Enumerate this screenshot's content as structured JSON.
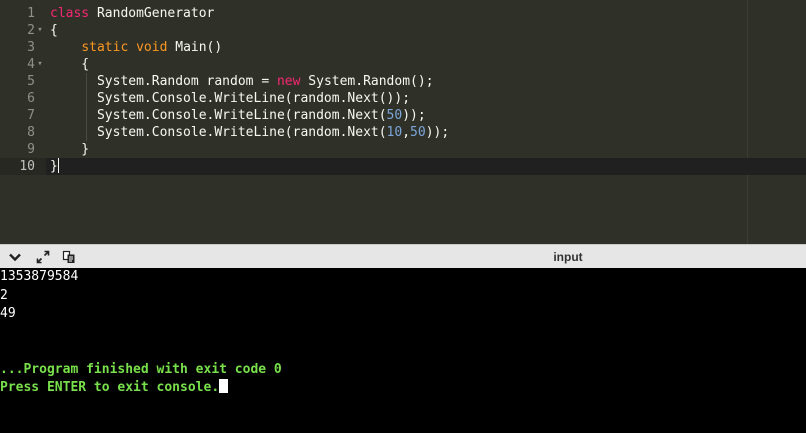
{
  "editor": {
    "line_numbers": [
      "1",
      "2",
      "3",
      "4",
      "5",
      "6",
      "7",
      "8",
      "9",
      "10"
    ],
    "code": {
      "l1_kw": "class",
      "l1_rest": " RandomGenerator",
      "l2": "{",
      "l3_indent": "    ",
      "l3_kw1": "static",
      "l3_sp": " ",
      "l3_kw2": "void",
      "l3_rest": " Main()",
      "l4": "    {",
      "l5_a": "      System.Random random = ",
      "l5_kw": "new",
      "l5_b": " System.Random();",
      "l6": "      System.Console.WriteLine(random.Next());",
      "l7_a": "      System.Console.WriteLine(random.Next(",
      "l7_num": "50",
      "l7_b": "));",
      "l8_a": "      System.Console.WriteLine(random.Next(",
      "l8_num1": "10",
      "l8_comma": ",",
      "l8_num2": "50",
      "l8_b": "));",
      "l9": "    }",
      "l10": "}"
    }
  },
  "toolbar": {
    "input_label": "input",
    "collapse_icon": "chevron-down-icon",
    "expand_icon": "expand-arrows-icon",
    "copy_icon": "copy-icon"
  },
  "console": {
    "lines": [
      "1353879584",
      "2",
      "49"
    ],
    "finish_message": "...Program finished with exit code 0",
    "exit_prompt": "Press ENTER to exit console."
  },
  "colors": {
    "editor_bg": "#2f3129",
    "keyword": "#f92672",
    "keyword_type": "#fd971f",
    "number": "#7aa6da",
    "console_bg": "#000000",
    "console_success": "#77e04a"
  }
}
